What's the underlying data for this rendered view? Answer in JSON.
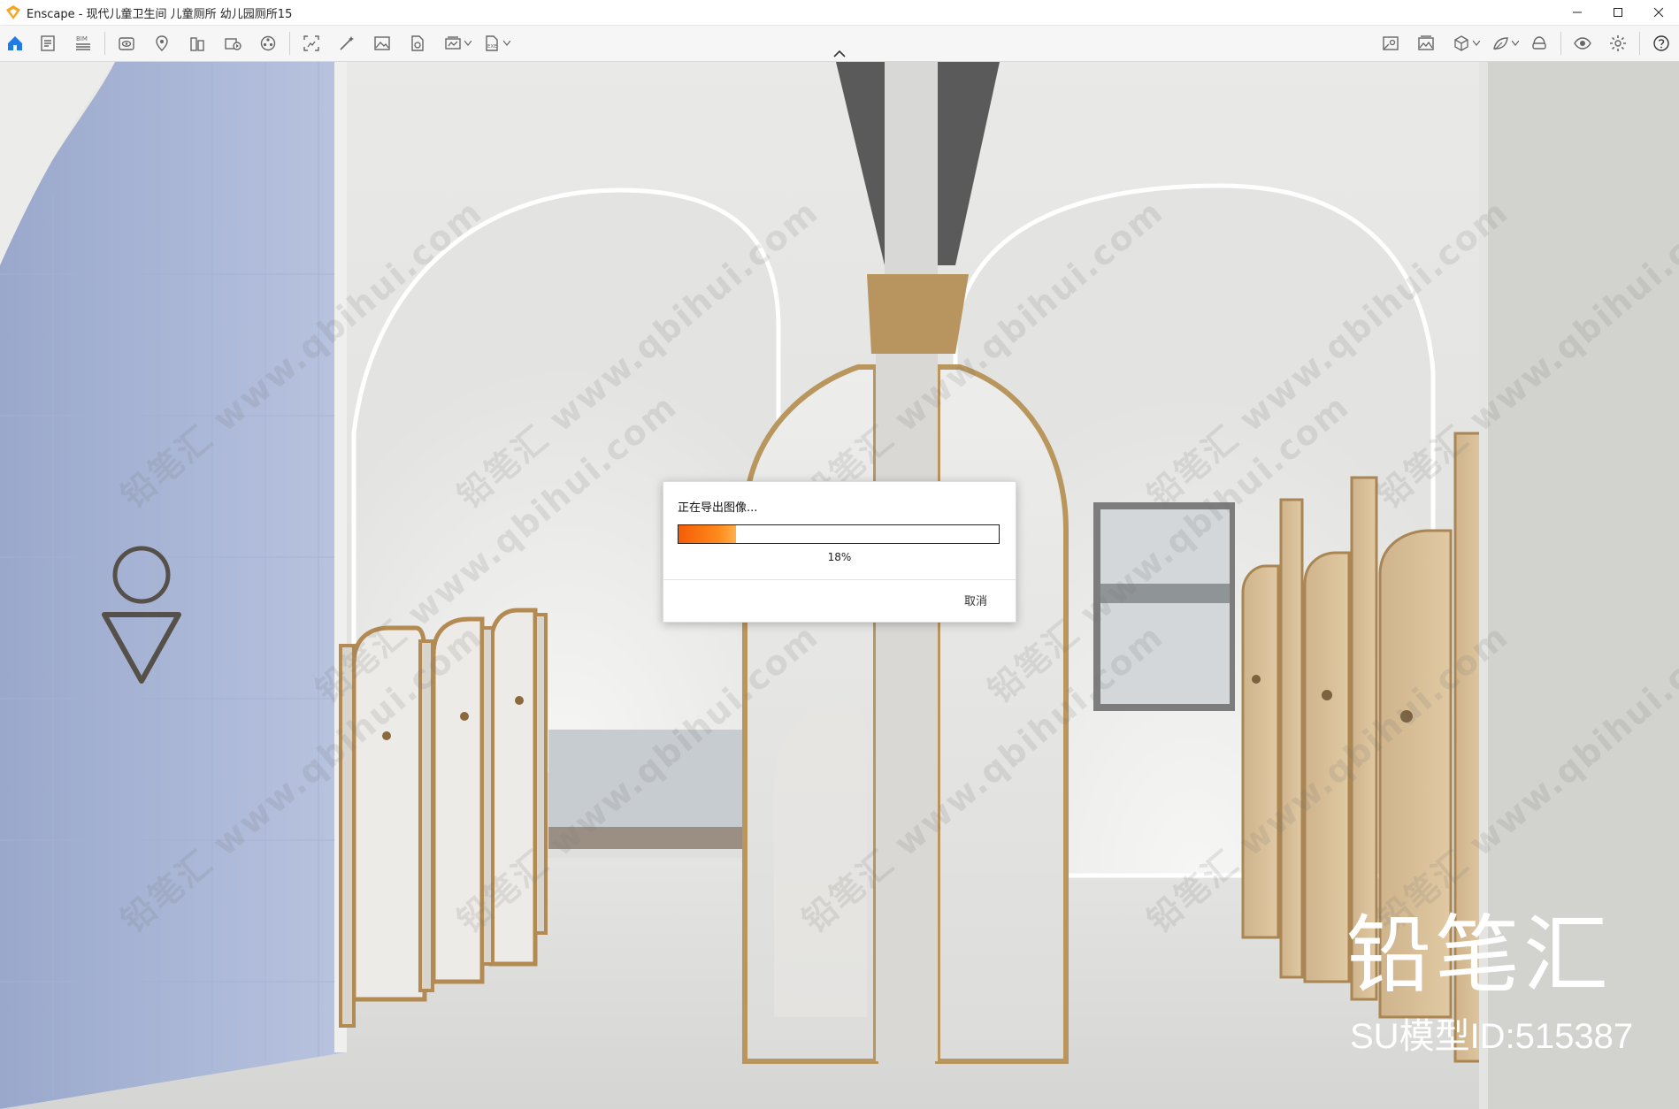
{
  "window": {
    "title": "Enscape - 现代儿童卫生间 儿童厕所 幼儿园厕所15"
  },
  "toolbar": {
    "left_buttons": [
      {
        "icon": "home-icon"
      },
      {
        "icon": "document-icon"
      },
      {
        "icon": "bim-icon",
        "label": "BIM"
      },
      {
        "icon": "eye-view-icon"
      },
      {
        "icon": "location-pin-icon"
      },
      {
        "icon": "building-icon"
      },
      {
        "icon": "video-editor-icon"
      },
      {
        "icon": "asset-library-icon"
      },
      {
        "icon": "screenshot-icon"
      },
      {
        "icon": "magic-wand-icon"
      },
      {
        "icon": "image-icon"
      },
      {
        "icon": "panorama-upload-icon"
      },
      {
        "icon": "batch-render-icon"
      },
      {
        "icon": "exe-export-icon",
        "label": "EXE"
      }
    ],
    "right_buttons": [
      {
        "icon": "map-view-icon"
      },
      {
        "icon": "gallery-icon"
      },
      {
        "icon": "cube-view-icon"
      },
      {
        "icon": "leaf-material-icon"
      },
      {
        "icon": "vr-headset-icon"
      },
      {
        "icon": "visual-settings-icon"
      },
      {
        "icon": "settings-icon"
      },
      {
        "icon": "help-icon"
      }
    ]
  },
  "scene": {
    "watermark_text": "铅笔汇 www.qbihui.com",
    "brand_name": "铅笔汇",
    "model_id": "SU模型ID:515387"
  },
  "dialog": {
    "message": "正在导出图像...",
    "progress": 0.18,
    "progress_label": "18%",
    "cancel_label": "取消",
    "progress_color": "#f45d06"
  }
}
